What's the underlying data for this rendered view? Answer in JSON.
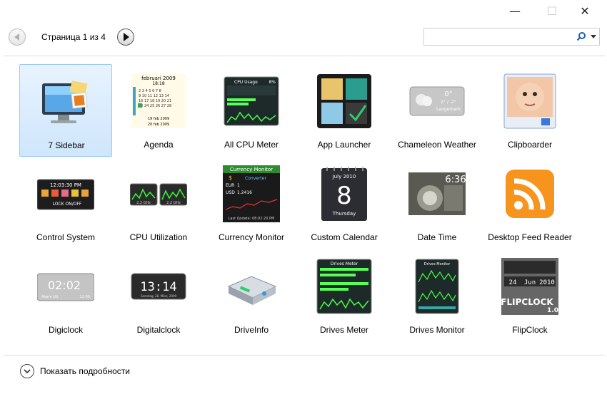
{
  "window": {
    "minimize": "—",
    "maximize": "☐",
    "close": "✕"
  },
  "pager": {
    "label": "Страница 1 из 4"
  },
  "search": {
    "placeholder": "",
    "value": ""
  },
  "gadgets": [
    {
      "name": "7 Sidebar",
      "icon": "monitor-sidebar-icon"
    },
    {
      "name": "Agenda",
      "icon": "calendar-agenda-icon",
      "month": "februari 2009",
      "time": "18:18",
      "footer": "19 feb 2009",
      "footer2": "20 feb 2009"
    },
    {
      "name": "All CPU Meter",
      "icon": "cpu-meter-icon",
      "title": "CPU Usage",
      "percent": "8%"
    },
    {
      "name": "App Launcher",
      "icon": "app-launcher-icon"
    },
    {
      "name": "Chameleon Weather",
      "icon": "weather-icon",
      "temp": "0°",
      "range": "2° / -2°",
      "city": "Langemark"
    },
    {
      "name": "Clipboarder",
      "icon": "clipboarder-icon"
    },
    {
      "name": "Control System",
      "icon": "control-system-icon",
      "time": "12:03:30 PM",
      "lock": "LOCK ON/OFF"
    },
    {
      "name": "CPU Utilization",
      "icon": "cpu-utilization-icon",
      "ghz1": "2.2 GHz",
      "ghz2": "2.2 GHz"
    },
    {
      "name": "Currency Monitor",
      "icon": "currency-monitor-icon",
      "title": "Currency Monitor",
      "conv": "Converter",
      "eur": "EUR",
      "eur_v": "1",
      "usd": "USD",
      "usd_v": "1.2416",
      "update": "Last Update: 08:02:20 PM"
    },
    {
      "name": "Custom Calendar",
      "icon": "custom-calendar-icon",
      "month": "July 2010",
      "day": "8",
      "weekday": "Thursday"
    },
    {
      "name": "Date Time",
      "icon": "date-time-icon",
      "time": "6:36"
    },
    {
      "name": "Desktop Feed Reader",
      "icon": "rss-feed-icon"
    },
    {
      "name": "Digiclock",
      "icon": "digiclock-icon",
      "time": "02:02",
      "sub": "Alarm Uit",
      "sub2": "12:00"
    },
    {
      "name": "Digitalclock",
      "icon": "digitalclock-icon",
      "time": "13:14",
      "date": "Samstag, 28. März, 2009"
    },
    {
      "name": "DriveInfo",
      "icon": "drive-info-icon"
    },
    {
      "name": "Drives Meter",
      "icon": "drives-meter-icon",
      "title": "Drives Meter"
    },
    {
      "name": "Drives Monitor",
      "icon": "drives-monitor-icon",
      "title": "Drives Monitor"
    },
    {
      "name": "FlipClock",
      "icon": "flipclock-icon",
      "d1": "24",
      "d2": "Jun",
      "d3": "2010",
      "brand": "FLIPCLOCK",
      "ver": "1.0"
    }
  ],
  "details": {
    "label": "Показать подробности"
  }
}
